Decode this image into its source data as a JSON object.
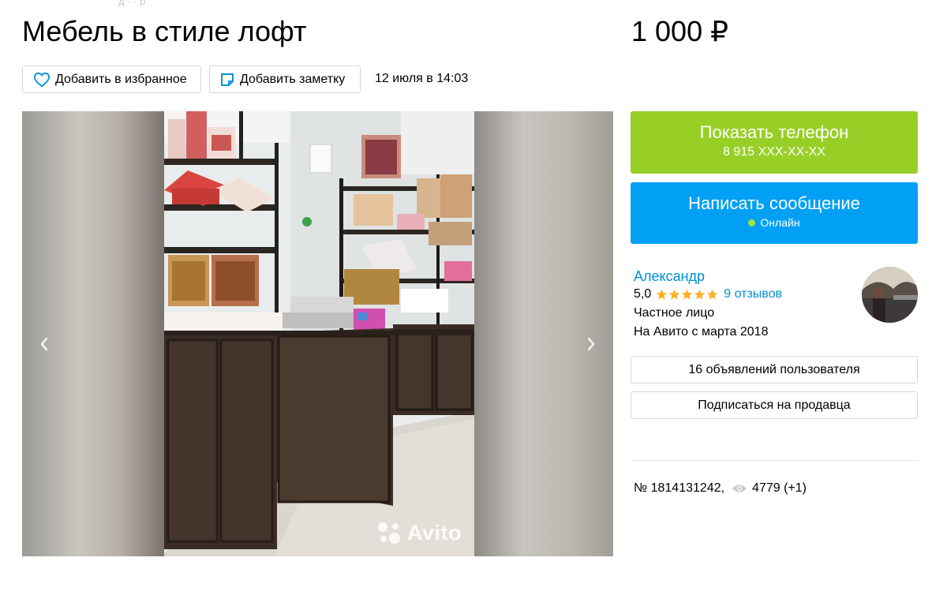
{
  "breadcrumbs": "д  ·  ·  р",
  "listing": {
    "title": "Мебель в стиле лофт",
    "price": "1 000 ₽",
    "date": "12 июля в 14:03",
    "number": "№ 1814131242,",
    "views": "4779 (+1)"
  },
  "actions": {
    "favorite_label": "Добавить в избранное",
    "note_label": "Добавить заметку"
  },
  "gallery": {
    "watermark": "Avito",
    "prev_icon": "chevron-left-icon",
    "next_icon": "chevron-right-icon"
  },
  "contact": {
    "phone_label": "Показать телефон",
    "phone_masked": "8 915 XXX-XX-XX",
    "message_label": "Написать сообщение",
    "online_label": "Онлайн"
  },
  "seller": {
    "name": "Александр",
    "rating": "5,0",
    "stars": 5,
    "reviews": "9 отзывов",
    "type": "Частное лицо",
    "since": "На Авито с марта 2018",
    "ads_button": "16 объявлений пользователя",
    "subscribe_button": "Подписаться на продавца"
  },
  "colors": {
    "phone_button": "#97cf26",
    "message_button": "#02a0f4",
    "link": "#0091d9",
    "star": "#ffb021",
    "online": "#a6e23c"
  }
}
